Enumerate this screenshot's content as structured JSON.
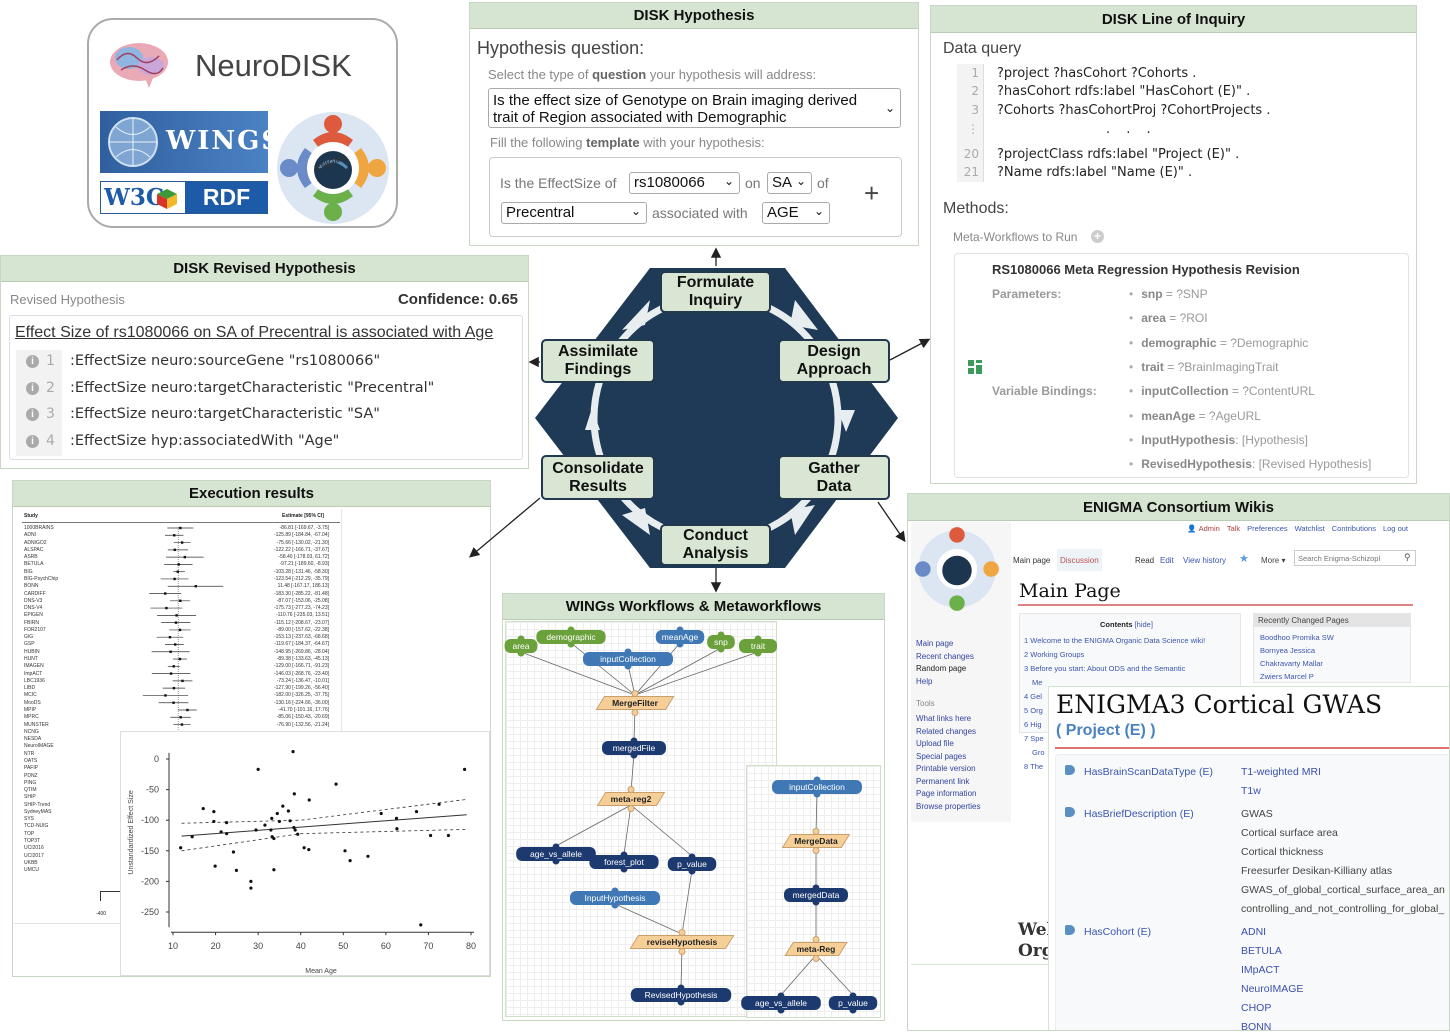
{
  "logo": {
    "title": "NeuroDISK",
    "wings": "WINGS",
    "w3c": "W3C",
    "rdf": "RDF",
    "enigma": "ENIGMA"
  },
  "hypothesis": {
    "header": "DISK Hypothesis",
    "question_label": "Hypothesis question:",
    "select_hint_pre": "Select the type of ",
    "select_hint_bold": "question",
    "select_hint_post": " your hypothesis will address:",
    "question_value_1": "Is the effect size of Genotype on Brain imaging derived",
    "question_value_2": "trait of Region associated with Demographic",
    "template_hint_pre": "Fill the following ",
    "template_hint_bold": "template",
    "template_hint_post": " with your hypothesis:",
    "t_is": "Is the EffectSize of",
    "t_snp": "rs1080066",
    "t_on": "on",
    "t_trait": "SA",
    "t_of": "of",
    "t_region": "Precentral",
    "t_assoc": "associated with",
    "t_demo": "AGE",
    "add": "+"
  },
  "inquiry": {
    "header": "DISK Line of Inquiry",
    "data_query": "Data query",
    "query_lines": [
      {
        "n": "1",
        "code": "?project ?hasCohort ?Cohorts ."
      },
      {
        "n": "2",
        "code": "?hasCohort rdfs:label \"HasCohort (E)\" ."
      },
      {
        "n": "3",
        "code": "?Cohorts ?hasCohortProj ?CohortProjects ."
      },
      {
        "n": "⋮",
        "code": ". . ."
      },
      {
        "n": "20",
        "code": "?projectClass rdfs:label \"Project (E)\" ."
      },
      {
        "n": "21",
        "code": "?Name rdfs:label \"Name (E)\" ."
      }
    ],
    "methods": "Methods:",
    "meta_workflows": "Meta-Workflows to Run",
    "card_title": "RS1080066 Meta Regression Hypothesis Revision",
    "parameters_label": "Parameters:",
    "bindings_label": "Variable Bindings:",
    "bullets": [
      {
        "k": "snp",
        "sep": " = ",
        "v": "?SNP"
      },
      {
        "k": "area",
        "sep": " = ",
        "v": "?ROI"
      },
      {
        "k": "demographic",
        "sep": " = ",
        "v": "?Demographic"
      },
      {
        "k": "trait",
        "sep": " = ",
        "v": "?BrainImagingTrait"
      },
      {
        "k": "inputCollection",
        "sep": " = ",
        "v": "?ContentURL"
      },
      {
        "k": "meanAge",
        "sep": " = ",
        "v": "?AgeURL"
      },
      {
        "k": "InputHypothesis",
        "sep": ": ",
        "v": "[Hypothesis]"
      },
      {
        "k": "RevisedHypothesis",
        "sep": ": ",
        "v": "[Revised Hypothesis]"
      }
    ]
  },
  "revised": {
    "header": "DISK Revised Hypothesis",
    "label": "Revised Hypothesis",
    "confidence": "Confidence: 0.65",
    "statement": "Effect Size of rs1080066 on SA of Precentral is associated with Age",
    "triples": [
      {
        "n": "1",
        "t": ":EffectSize neuro:sourceGene \"rs1080066\""
      },
      {
        "n": "2",
        "t": ":EffectSize neuro:targetCharacteristic \"Precentral\""
      },
      {
        "n": "3",
        "t": ":EffectSize neuro:targetCharacteristic \"SA\""
      },
      {
        "n": "4",
        "t": ":EffectSize hyp:associatedWith \"Age\""
      }
    ]
  },
  "cycle": {
    "formulate": "Formulate Inquiry",
    "design": "Design Approach",
    "gather": "Gather Data",
    "conduct": "Conduct Analysis",
    "consolidate": "Consolidate Results",
    "assimilate": "Assimilate Findings",
    "hex_color": "#1f3a57",
    "box_color": "#d8e6d3"
  },
  "execution": {
    "header": "Execution results",
    "forest": {
      "col_study": "Study",
      "col_estimate": "Estimate [95% CI]",
      "studies": [
        "1000BRAINS",
        "ADNI",
        "ADNIGO2",
        "ALSPAC",
        "ASRB",
        "BETULA",
        "BIG",
        "BIG-PsychChip",
        "BONN",
        "CARDIFF",
        "DNS-V3",
        "DNS-V4",
        "EPIGEN",
        "FBIRN",
        "FOR2107",
        "GIG",
        "GSP",
        "HUBIN",
        "HUNT",
        "IMAGEN",
        "ImpACT",
        "LBC1936",
        "LIBD",
        "MCIC",
        "MooDS",
        "MPIP",
        "MPRC",
        "MUNSTER",
        "NCNG",
        "NESDA",
        "NeuroIMAGE",
        "NTR",
        "OATS",
        "PAFIP",
        "PDNZ",
        "PING",
        "QTIM",
        "SHIP",
        "SHIP-Trend",
        "SydneyMAS",
        "SYS",
        "TCD-NUIG",
        "TOP",
        "TOP3T",
        "UCI2016",
        "UCI2017",
        "UKBB",
        "UMCU"
      ],
      "estimates": [
        [
          -86.81,
          -169.67,
          -3.75
        ],
        [
          -125.89,
          -184.84,
          -67.04
        ],
        [
          -75.66,
          -130.02,
          -21.3
        ],
        [
          -122.22,
          -166.71,
          -37.67
        ],
        [
          -58.4,
          -178.03,
          61.72
        ],
        [
          -97.21,
          -189.6,
          -8.93
        ],
        [
          -103.28,
          -131.46,
          -58.3
        ],
        [
          -123.54,
          -212.29,
          -35.79
        ],
        [
          11.48,
          -167.17,
          186.13
        ],
        [
          -183.3,
          -285.22,
          -81.48
        ],
        [
          -87.07,
          -153.06,
          -25.08
        ],
        [
          -175.73,
          -277.23,
          -74.23
        ],
        [
          -110.76,
          -235.03,
          13.51
        ],
        [
          -115.12,
          -208.67,
          -23.07
        ],
        [
          -89.0,
          -157.62,
          -22.38
        ],
        [
          -153.13,
          -237.63,
          -68.68
        ],
        [
          -119.67,
          -184.37,
          -64.67
        ],
        [
          -148.95,
          -269.86,
          -28.04
        ],
        [
          -89.38,
          -133.63,
          -45.13
        ],
        [
          -129.0,
          -166.71,
          -91.23
        ],
        [
          -146.03,
          -268.76,
          -23.4
        ],
        [
          -73.24,
          -136.47,
          -10.01
        ],
        [
          -127.9,
          -199.26,
          -56.4
        ],
        [
          -182.0,
          -326.25,
          -37.75
        ],
        [
          -130.16,
          -224.66,
          -36.0
        ],
        [
          -41.7,
          -101.16,
          17.76
        ],
        [
          -85.06,
          -150.43,
          -20.69
        ],
        [
          -76.9,
          -132.56,
          -21.24
        ]
      ],
      "axis_tick": "-400"
    }
  },
  "chart_data": {
    "type": "scatter",
    "xlabel": "Mean Age",
    "ylabel": "Unstandardized Effect Size",
    "xlim": [
      10,
      80
    ],
    "ylim": [
      -275,
      10
    ],
    "xticks": [
      10,
      20,
      30,
      40,
      50,
      60,
      70,
      80
    ],
    "yticks": [
      0,
      -50,
      -100,
      -150,
      -200,
      -250
    ],
    "points": [
      [
        38.2,
        12
      ],
      [
        30,
        -17
      ],
      [
        78.5,
        -17
      ],
      [
        48.3,
        -41
      ],
      [
        38.5,
        -57
      ],
      [
        42,
        -67
      ],
      [
        17.1,
        -81
      ],
      [
        19.6,
        -86
      ],
      [
        35.8,
        -77
      ],
      [
        37.1,
        -85
      ],
      [
        34.5,
        -89
      ],
      [
        58.9,
        -89
      ],
      [
        67.2,
        -86
      ],
      [
        72.5,
        -74
      ],
      [
        33.2,
        -97
      ],
      [
        35,
        -102
      ],
      [
        37.5,
        -101
      ],
      [
        19.6,
        -102
      ],
      [
        22.6,
        -104
      ],
      [
        62.5,
        -97
      ],
      [
        31.6,
        -108
      ],
      [
        29.5,
        -116
      ],
      [
        33,
        -116
      ],
      [
        38.4,
        -112
      ],
      [
        38.7,
        -116
      ],
      [
        21.3,
        -119
      ],
      [
        22.6,
        -122
      ],
      [
        39.3,
        -123
      ],
      [
        62.6,
        -114
      ],
      [
        14.5,
        -127
      ],
      [
        33.3,
        -127
      ],
      [
        33.7,
        -130
      ],
      [
        70.5,
        -125
      ],
      [
        74.7,
        -125
      ],
      [
        11.8,
        -145
      ],
      [
        24.2,
        -152
      ],
      [
        40.8,
        -145
      ],
      [
        41.9,
        -148
      ],
      [
        50.4,
        -150
      ],
      [
        51.6,
        -166
      ],
      [
        55.8,
        -159
      ],
      [
        19.9,
        -175
      ],
      [
        24.9,
        -182
      ],
      [
        33.7,
        -181
      ],
      [
        28.3,
        -200
      ],
      [
        28.3,
        -211
      ],
      [
        68.2,
        -271
      ]
    ],
    "fit_line": [
      [
        12,
        -126
      ],
      [
        79,
        -91
      ]
    ],
    "ci_upper": [
      [
        12,
        -105
      ],
      [
        40,
        -100
      ],
      [
        79,
        -66
      ]
    ],
    "ci_lower": [
      [
        12,
        -150
      ],
      [
        40,
        -122
      ],
      [
        79,
        -115
      ]
    ],
    "grid": false
  },
  "workflows": {
    "header": "WINGs Workflows & Metaworkflows",
    "colors": {
      "parameter": "#6aa13a",
      "input": "#3f78b5",
      "data": "#1d3a70",
      "component": "#f6cf98"
    },
    "nodes": {
      "area": "area",
      "demographic": "demographic",
      "inputCollection": "inputCollection",
      "meanAge": "meanAge",
      "snp": "snp",
      "trait": "trait",
      "MergeFilter": "MergeFilter",
      "mergedFile": "mergedFile",
      "metareg2": "meta-reg2",
      "age1": "age_vs_allele",
      "forest": "forest_plot",
      "p1": "p_value",
      "InputHypothesis": "InputHypothesis",
      "revise": "reviseHypothesis",
      "Revised": "RevisedHypothesis",
      "inputCollection2": "inputCollection",
      "MergeData": "MergeData",
      "mergedData": "mergedData",
      "metaReg": "meta-Reg",
      "age2": "age_vs_allele",
      "p2": "p_value"
    }
  },
  "wiki": {
    "header": "ENIGMA Consortium Wikis",
    "user_links": [
      "Admin",
      "Talk",
      "Preferences",
      "Watchlist",
      "Contributions",
      "Log out"
    ],
    "tabs": {
      "main": "Main page",
      "discussion": "Discussion",
      "read": "Read",
      "edit": "Edit",
      "history": "View history",
      "more": "More ▾"
    },
    "search_placeholder": "Search Enigma-Schizopl",
    "page_title": "Main Page",
    "contents_title": "Contents",
    "contents_hide": "[hide]",
    "contents": [
      "1  Welcome to the ENIGMA Organic Data Science wiki!",
      "2  Working Groups",
      "3  Before you start: About ODS and the Semantic",
      "Me",
      "4  Gel",
      "5  Org",
      "6  Hig",
      "7  Spe",
      "Gro",
      "8  The"
    ],
    "recent_title": "Recently Changed Pages",
    "recent": [
      "Boodhoo Promika SW",
      "Bornyea Jessica",
      "Chakravarty Mallar",
      "Zwiers Marcel P"
    ],
    "sidebar_nav": [
      "Main page",
      "Recent changes",
      "Random page",
      "Help"
    ],
    "tools_label": "Tools",
    "sidebar_tools": [
      "What links here",
      "Related changes",
      "Upload file",
      "Special pages",
      "Printable version",
      "Permanent link",
      "Page information",
      "Browse properties"
    ],
    "welcome_frag_1": "Wel",
    "welcome_frag_2": "Org",
    "project": {
      "title": "ENIGMA3 Cortical GWAS",
      "subtitle": "( Project (E) )",
      "props": [
        {
          "name": "HasBrainScanDataType (E)",
          "values": [
            "T1-weighted MRI",
            "T1w"
          ],
          "link": true
        },
        {
          "name": "HasBriefDescription (E)",
          "values": [
            "GWAS",
            "Cortical surface area",
            "Cortical thickness",
            "Freesurfer Desikan-Killiany atlas",
            "GWAS_of_global_cortical_surface_area_an",
            "controlling_and_not_controlling_for_global_"
          ],
          "link": false
        },
        {
          "name": "HasCohort (E)",
          "values": [
            "ADNI",
            "BETULA",
            "IMpACT",
            "NeuroIMAGE",
            "CHOP",
            "BONN"
          ],
          "link": true
        }
      ]
    }
  }
}
